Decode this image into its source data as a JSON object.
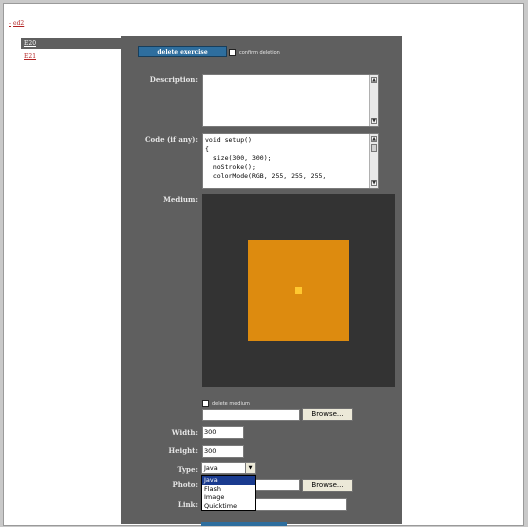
{
  "top_link": {
    "dash": "-",
    "text": "ed2"
  },
  "sidebar": {
    "items": [
      {
        "label": "E20"
      },
      {
        "label": "E21"
      }
    ]
  },
  "exercise": {
    "delete_button": "delete exercise",
    "confirm_label": "confirm deletion"
  },
  "fields": {
    "description_label": "Description:",
    "description_value": "",
    "code_label": "Code (if any):",
    "code_lines": [
      "void setup()",
      "{",
      "  size(300, 300);",
      "  noStroke();",
      "  colorMode(RGB, 255, 255, 255,"
    ],
    "medium_label": "Medium:",
    "delete_medium_label": "delete medium",
    "browse_label": "Browse...",
    "width_label": "Width:",
    "width_value": "300",
    "height_label": "Height:",
    "height_value": "300",
    "type_label": "Type:",
    "type_value": "Java",
    "type_options": [
      "Java",
      "Flash",
      "Image",
      "Quicktime"
    ],
    "photo_label": "Photo:",
    "link_label": "Link:",
    "link_value": ""
  },
  "colors": {
    "panel": "#5f5f5f",
    "medium_bg": "#333333",
    "square": "#dd8b0f",
    "dot": "#ffc830",
    "button": "#2e6e9e"
  }
}
